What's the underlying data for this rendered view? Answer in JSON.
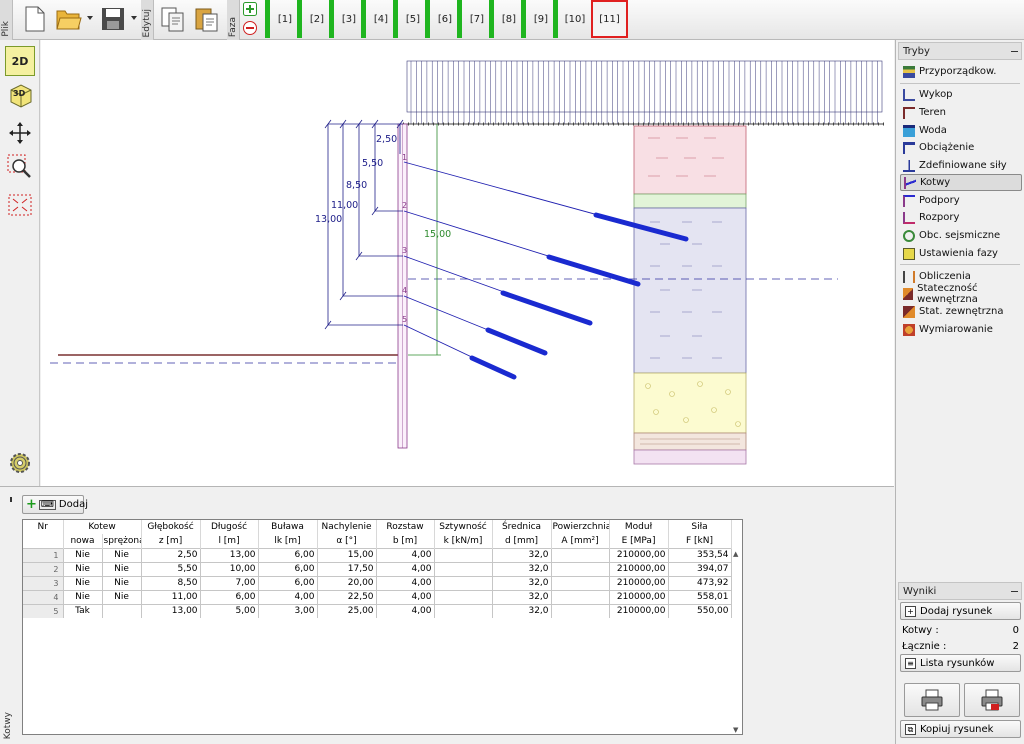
{
  "toolbar": {
    "tabs": {
      "file": "Plik",
      "edit": "Edytuj",
      "phase": "Faza"
    },
    "phases": [
      "[1]",
      "[2]",
      "[3]",
      "[4]",
      "[5]",
      "[6]",
      "[7]",
      "[8]",
      "[9]",
      "[10]",
      "[11]"
    ],
    "active_phase": "[11]"
  },
  "left_tools": {
    "view2d": "2D",
    "view3d": "3D"
  },
  "drawing": {
    "dims": [
      "2,50",
      "5,50",
      "8,50",
      "11,00",
      "13,00"
    ],
    "wall_height": "15,00",
    "anchor_numbers": [
      "1",
      "2",
      "3",
      "4",
      "5"
    ]
  },
  "modes_panel": {
    "title": "Tryby",
    "items": [
      "Przyporządkow.",
      "Wykop",
      "Teren",
      "Woda",
      "Obciążenie",
      "Zdefiniowane siły",
      "Kotwy",
      "Podpory",
      "Rozpory",
      "Obc. sejsmiczne",
      "Ustawienia fazy",
      "Obliczenia",
      "Stateczność wewnętrzna",
      "Stat. zewnętrzna",
      "Wymiarowanie"
    ],
    "selected": "Kotwy"
  },
  "results_panel": {
    "title": "Wyniki",
    "add_drawing": "Dodaj rysunek",
    "anchors_label": "Kotwy :",
    "anchors_value": "0",
    "total_label": "Łącznie :",
    "total_value": "2",
    "drawing_list": "Lista rysunków",
    "copy_drawing": "Kopiuj rysunek"
  },
  "bottom": {
    "side_tab": "Kotwy",
    "add_button": "Dodaj",
    "table": {
      "headers_top": [
        "Nr",
        "Kotew",
        "Głębokość",
        "Długość",
        "Buława",
        "Nachylenie",
        "Rozstaw",
        "Sztywność",
        "Średnica",
        "Powierzchnia",
        "Moduł",
        "Siła"
      ],
      "headers_bottom": [
        "",
        "nowa",
        "sprężona",
        "z [m]",
        "l [m]",
        "lk [m]",
        "α [°]",
        "b [m]",
        "k [kN/m]",
        "d [mm]",
        "A [mm²]",
        "E [MPa]",
        "F [kN]"
      ],
      "rows": [
        [
          "1",
          "Nie",
          "Nie",
          "2,50",
          "13,00",
          "6,00",
          "15,00",
          "4,00",
          "",
          "32,0",
          "",
          "210000,00",
          "353,54"
        ],
        [
          "2",
          "Nie",
          "Nie",
          "5,50",
          "10,00",
          "6,00",
          "17,50",
          "4,00",
          "",
          "32,0",
          "",
          "210000,00",
          "394,07"
        ],
        [
          "3",
          "Nie",
          "Nie",
          "8,50",
          "7,00",
          "6,00",
          "20,00",
          "4,00",
          "",
          "32,0",
          "",
          "210000,00",
          "473,92"
        ],
        [
          "4",
          "Nie",
          "Nie",
          "11,00",
          "6,00",
          "4,00",
          "22,50",
          "4,00",
          "",
          "32,0",
          "",
          "210000,00",
          "558,01"
        ],
        [
          "5",
          "Tak",
          "",
          "13,00",
          "5,00",
          "3,00",
          "25,00",
          "4,00",
          "",
          "32,0",
          "",
          "210000,00",
          "550,00"
        ]
      ]
    }
  },
  "colors": {
    "phase_bar": "#1fb51f",
    "active_phase_border": "#e02020",
    "anchor_line": "#2020b0",
    "dimension": "#20208a",
    "wall_dim": "#2e8b2e"
  }
}
